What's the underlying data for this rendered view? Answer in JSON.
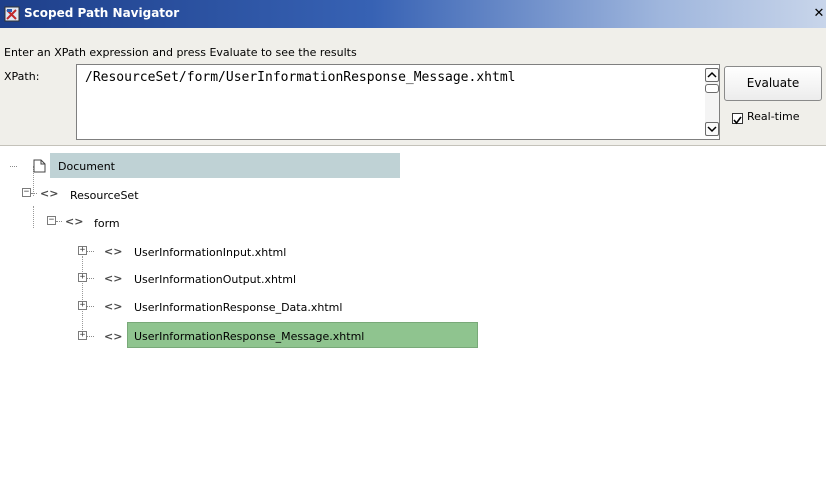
{
  "window": {
    "title": "Scoped Path Navigator",
    "close_glyph": "✕"
  },
  "panel": {
    "instruction": "Enter an XPath expression and press Evaluate to see the results",
    "xpath_label": "XPath:",
    "xpath_value": "/ResourceSet/form/UserInformationResponse_Message.xhtml",
    "evaluate_label": "Evaluate",
    "realtime_label": "Real-time",
    "realtime_checked": true
  },
  "tree": {
    "root": "Document",
    "nodes": [
      {
        "label": "ResourceSet",
        "expanded": true,
        "icon": "element-icon"
      },
      {
        "label": "form",
        "expanded": true,
        "icon": "element-icon"
      },
      {
        "label": "UserInformationInput.xhtml",
        "expanded": false,
        "icon": "element-icon"
      },
      {
        "label": "UserInformationOutput.xhtml",
        "expanded": false,
        "icon": "element-icon"
      },
      {
        "label": "UserInformationResponse_Data.xhtml",
        "expanded": false,
        "icon": "element-icon"
      },
      {
        "label": "UserInformationResponse_Message.xhtml",
        "expanded": false,
        "icon": "element-icon",
        "selected": true
      }
    ]
  },
  "colors": {
    "titlebar_start": "#1e3f8a",
    "selection": "#8fc48f",
    "root_highlight": "#bfd2d5"
  }
}
